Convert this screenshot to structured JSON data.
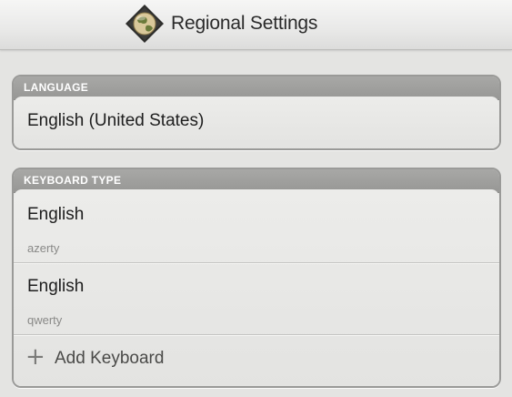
{
  "header": {
    "title": "Regional Settings",
    "icon": "globe-icon"
  },
  "language": {
    "section_label": "LANGUAGE",
    "value": "English (United States)"
  },
  "keyboard": {
    "section_label": "KEYBOARD TYPE",
    "items": [
      {
        "name": "English",
        "layout": "azerty"
      },
      {
        "name": "English",
        "layout": "qwerty"
      }
    ],
    "add_label": "Add Keyboard",
    "add_icon": "plus-icon"
  },
  "colors": {
    "background": "#e4e4e2",
    "section_header": "#9f9f9d",
    "text": "#1e1e1e"
  }
}
